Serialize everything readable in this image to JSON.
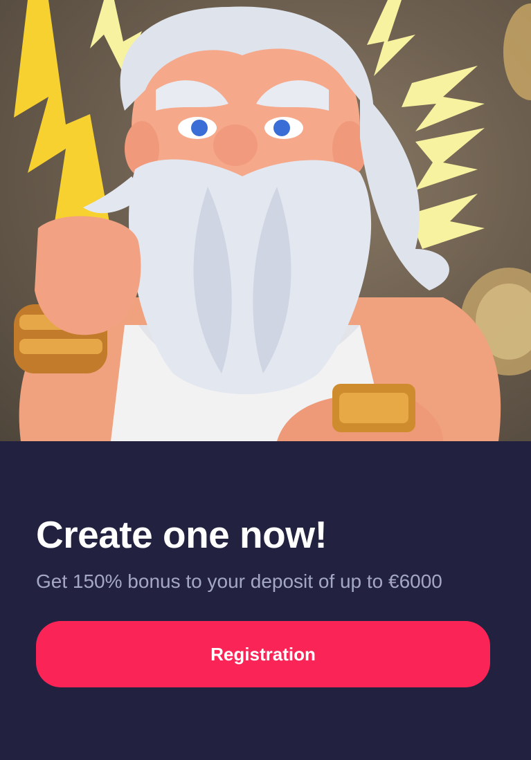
{
  "banner": {
    "image_subject": "zeus-character-illustration",
    "colors": {
      "background": "#222240",
      "accent": "#fb2457"
    }
  },
  "promo": {
    "title": "Create one now!",
    "subtitle": "Get 150% bonus to your deposit of up to €6000",
    "button_label": "Registration"
  }
}
